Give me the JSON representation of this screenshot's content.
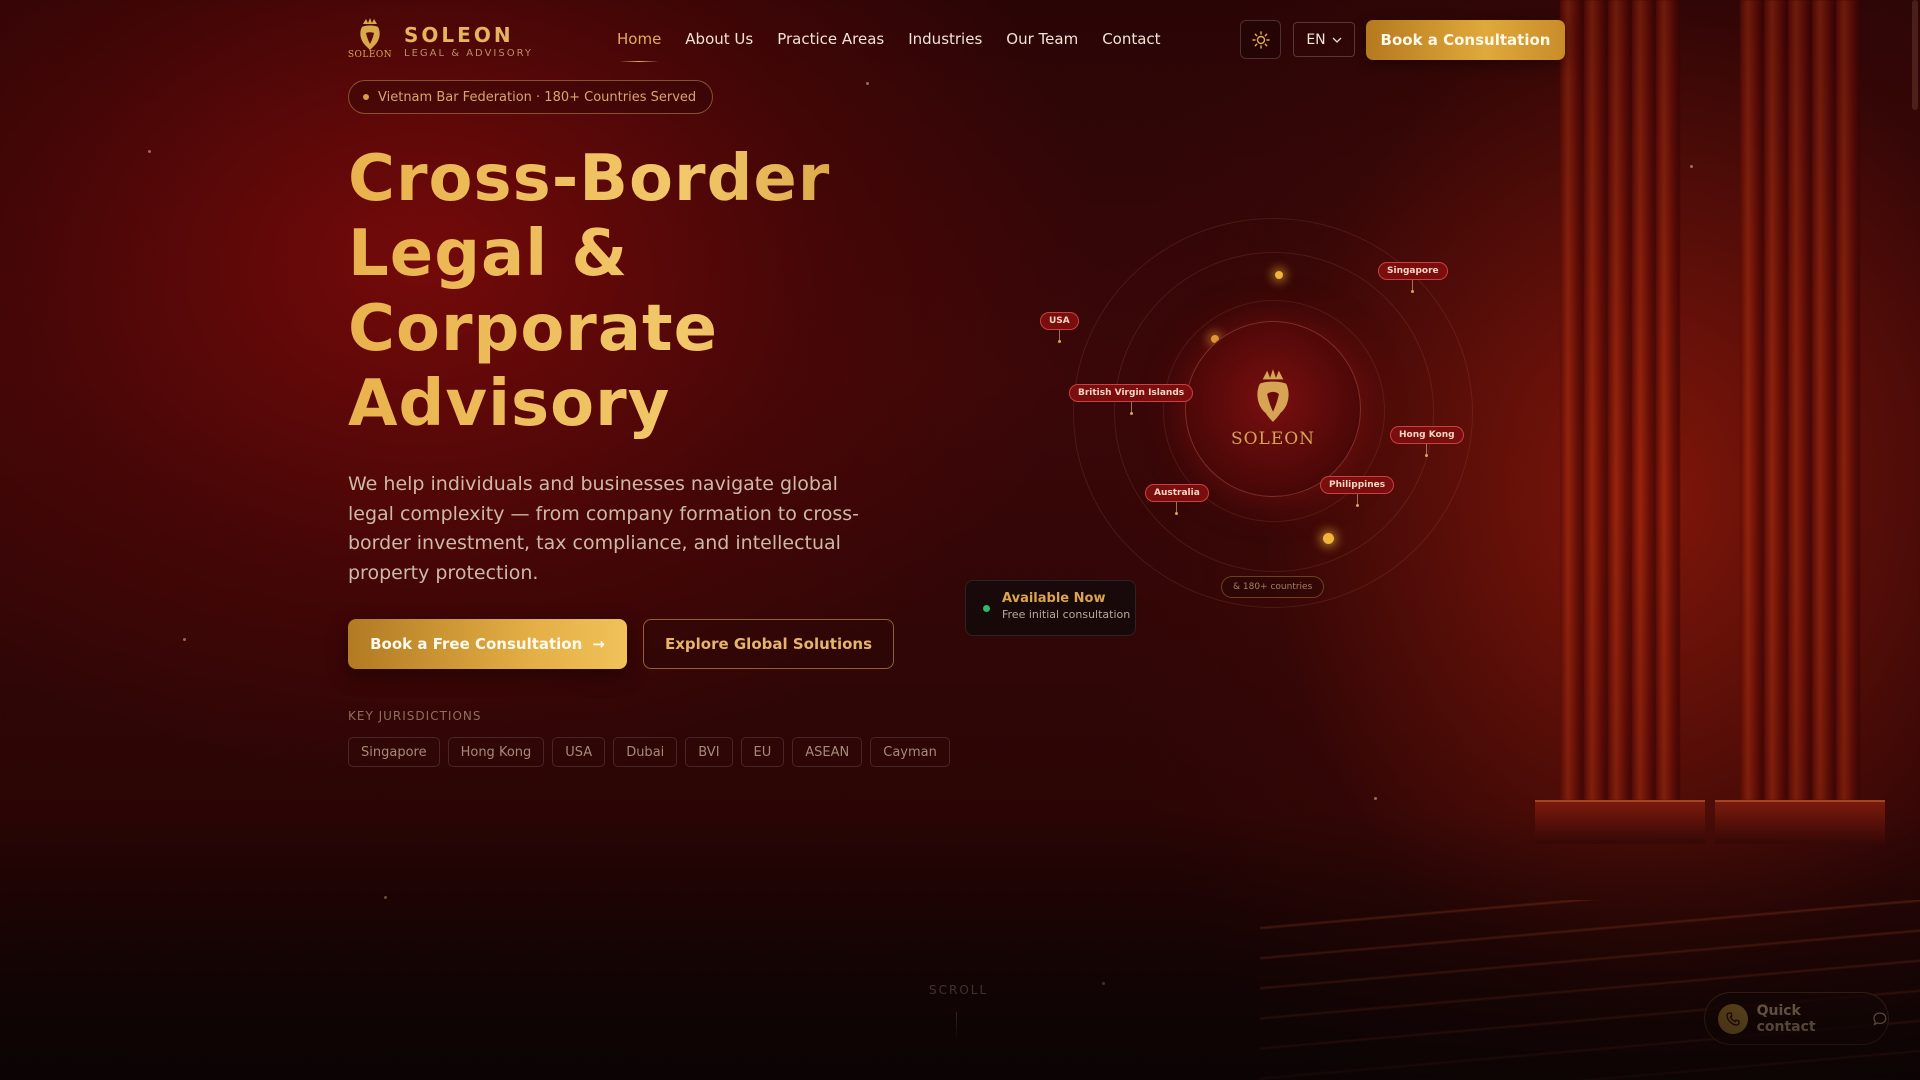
{
  "header": {
    "brand": "SOLEON",
    "brand_tagline": "LEGAL & ADVISORY",
    "logo_mini": "SOLEON",
    "nav": [
      "Home",
      "About Us",
      "Practice Areas",
      "Industries",
      "Our Team",
      "Contact"
    ],
    "active_nav": "Home",
    "theme_icon": "sun-icon",
    "language": "EN",
    "cta": "Book a Consultation"
  },
  "hero": {
    "badge": "Vietnam Bar Federation · 180+ Countries Served",
    "title_lines": [
      "Cross-Border",
      "Legal &",
      "Corporate",
      "Advisory"
    ],
    "description": "We help individuals and businesses navigate global legal complexity — from company formation to cross-border investment, tax compliance, and intellectual property protection.",
    "primary_cta": "Book a Free Consultation",
    "primary_cta_icon": "→",
    "secondary_cta": "Explore Global Solutions",
    "jurisdictions_label": "KEY JURISDICTIONS",
    "jurisdictions": [
      "Singapore",
      "Hong Kong",
      "USA",
      "Dubai",
      "BVI",
      "EU",
      "ASEAN",
      "Cayman"
    ]
  },
  "globe": {
    "core_name": "SOLEON",
    "pins": [
      "USA",
      "Singapore",
      "British Virgin Islands",
      "Hong Kong",
      "Australia",
      "Philippines"
    ],
    "more_countries": "& 180+ countries"
  },
  "availability": {
    "title": "Available Now",
    "subtitle": "Free initial consultation",
    "status_color": "#2fb86a"
  },
  "scroll_hint": "SCROLL",
  "quick_contact": {
    "label": "Quick contact",
    "icon": "phone-icon",
    "trailing_icon": "chat-bubble-icon"
  },
  "colors": {
    "accent_gold": "#e2ac5b",
    "background": "#3a0708"
  }
}
